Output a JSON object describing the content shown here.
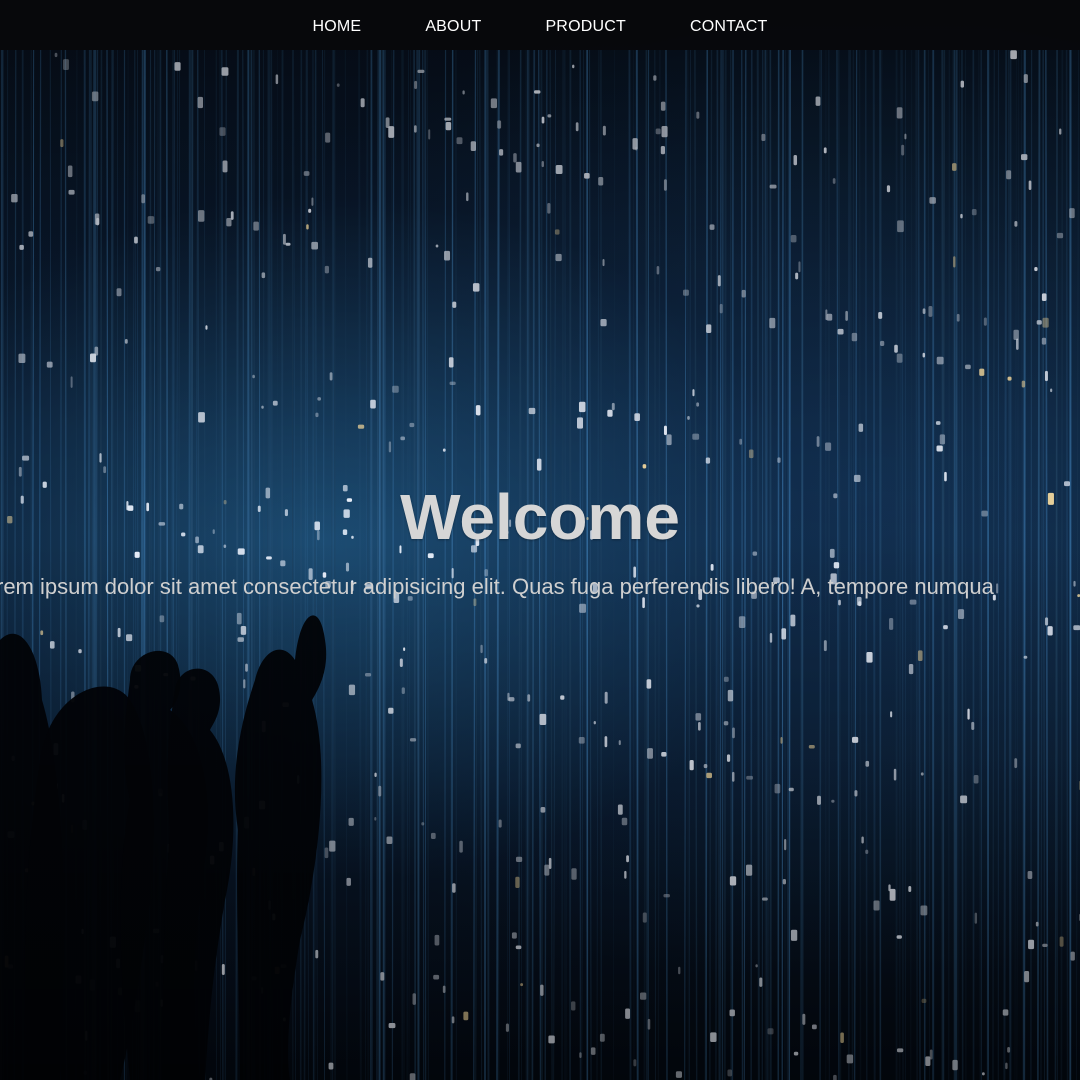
{
  "nav": {
    "items": [
      {
        "label": "HOME"
      },
      {
        "label": "ABOUT"
      },
      {
        "label": "PRODUCT"
      },
      {
        "label": "CONTACT"
      }
    ]
  },
  "hero": {
    "title": "Welcome",
    "text": "rem ipsum dolor sit amet consectetur adipisicing elit. Quas fuga perferendis libero! A, tempore numqua",
    "background_image": "light-installation-photo"
  },
  "colors": {
    "navbar_bg": "#0a0a0c",
    "nav_text": "#ffffff",
    "title_text": "#d6d6d6",
    "body_text": "#cfcfcf"
  }
}
